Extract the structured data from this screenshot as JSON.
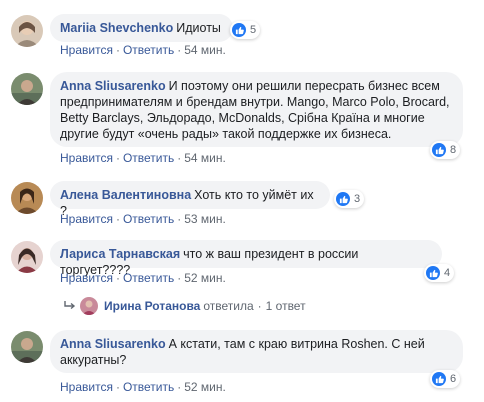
{
  "comments": [
    {
      "author": "Mariia Shevchenko",
      "text": "Идиоты",
      "likes": "5",
      "like_label": "Нравится",
      "reply_label": "Ответить",
      "time": "54 мин."
    },
    {
      "author": "Anna Sliusarenko",
      "text": "И поэтому они решили пересрать бизнес всем предпринимателям и брендам внутри. Mango, Marco Polo, Brocard, Betty Barclays, Эльдорадо, McDonalds, Срібна Країна и многие другие будут «очень рады» такой поддержке их бизнеса.",
      "likes": "8",
      "like_label": "Нравится",
      "reply_label": "Ответить",
      "time": "54 мин."
    },
    {
      "author": "Алена Валентиновна",
      "text": "Хоть кто то уймёт их ?",
      "likes": "3",
      "like_label": "Нравится",
      "reply_label": "Ответить",
      "time": "53 мин."
    },
    {
      "author": "Лариса Тарнавская",
      "text": "что ж ваш президент в россии торгует????",
      "likes": "4",
      "like_label": "Нравится",
      "reply_label": "Ответить",
      "time": "52 мин."
    },
    {
      "author": "Anna Sliusarenko",
      "text": "А кстати, там с краю витрина Roshen. С ней аккуратны?",
      "likes": "6",
      "like_label": "Нравится",
      "reply_label": "Ответить",
      "time": "52 мин."
    }
  ],
  "reply_thread": {
    "author": "Ирина Ротанова",
    "verb": "ответила",
    "count": "1 ответ"
  },
  "colors": {
    "link": "#385898",
    "bubble": "#f2f3f5",
    "like": "#2078f4",
    "meta": "#606770"
  }
}
